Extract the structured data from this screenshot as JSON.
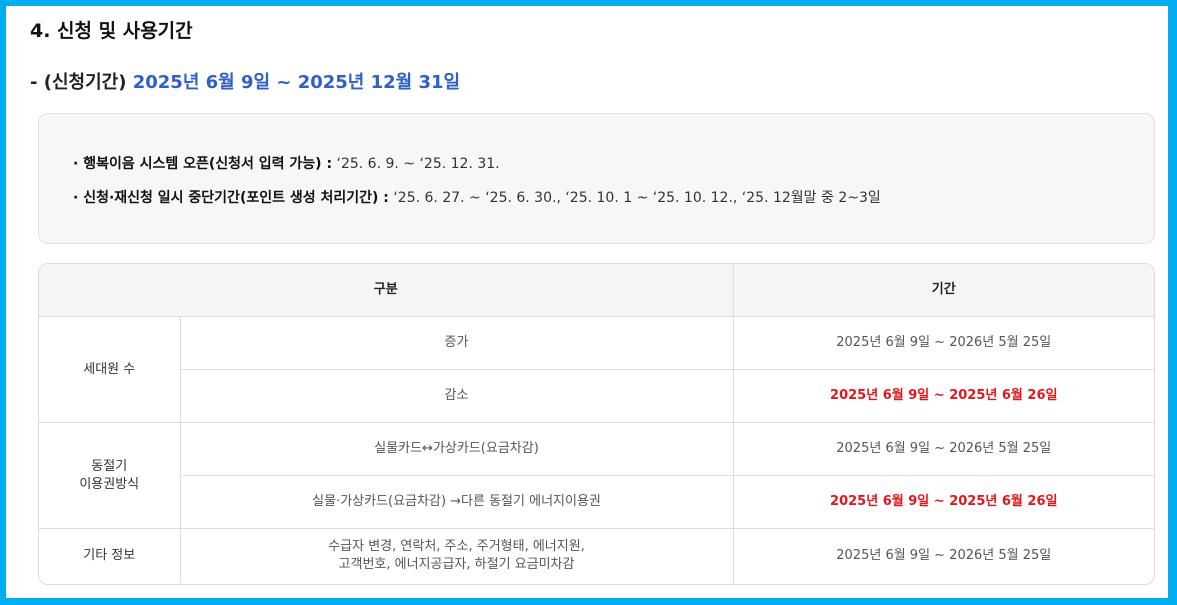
{
  "section_title": "4. 신청 및 사용기간",
  "period": {
    "prefix": "- (신청기간)",
    "range": "2025년 6월 9일 ~ 2025년 12월 31일"
  },
  "notices": [
    {
      "label": "· 행복이음 시스템 오픈(신청서 입력 가능) :",
      "value": " ‘25. 6. 9. ~ ‘25. 12. 31."
    },
    {
      "label": "· 신청·재신청 일시 중단기간(포인트 생성 처리기간) :",
      "value": " ‘25. 6. 27. ~ ‘25. 6. 30., ‘25. 10. 1 ~ ‘25. 10. 12., ‘25. 12월말 중 2~3일"
    }
  ],
  "table": {
    "headers": {
      "category": "구분",
      "period": "기간"
    },
    "groups": [
      {
        "category": "세대원 수",
        "rows": [
          {
            "item": "증가",
            "period": "2025년 6월 9일 ~ 2026년 5월 25일",
            "highlight": false
          },
          {
            "item": "감소",
            "period": "2025년 6월 9일 ~ 2025년 6월 26일",
            "highlight": true
          }
        ]
      },
      {
        "category_line1": "동절기",
        "category_line2": "이용권방식",
        "rows": [
          {
            "item": "실물카드↔가상카드(요금차감)",
            "period": "2025년 6월 9일 ~ 2026년 5월 25일",
            "highlight": false
          },
          {
            "item": "실물·가상카드(요금차감) →다른 동절기 에너지이용권",
            "period": "2025년 6월 9일 ~ 2025년 6월 26일",
            "highlight": true
          }
        ]
      },
      {
        "category": "기타 정보",
        "rows": [
          {
            "item_line1": "수급자 변경, 연락처, 주소, 주거형태, 에너지원,",
            "item_line2": "고객번호, 에너지공급자, 하절기 요금미차감",
            "period": "2025년 6월 9일 ~ 2026년 5월 25일",
            "highlight": false
          }
        ]
      }
    ]
  },
  "colors": {
    "frame_border": "#00adef",
    "highlight_blue": "#2f5fc8",
    "highlight_red": "#e3161b"
  }
}
